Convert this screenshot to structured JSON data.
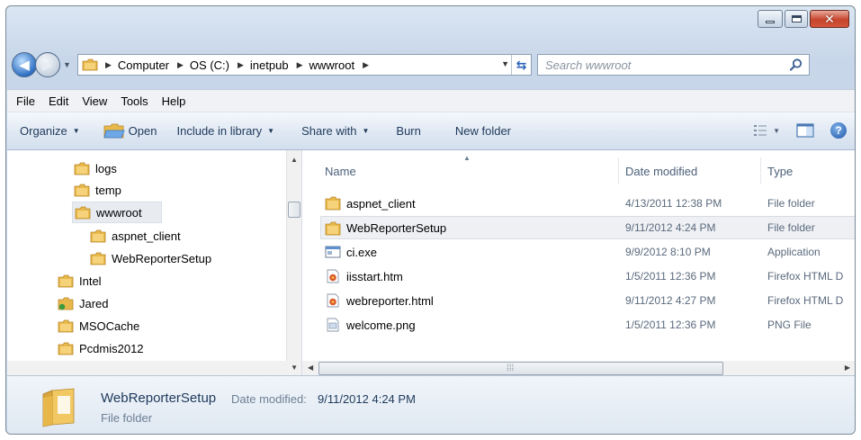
{
  "address": {
    "crumbs": [
      "Computer",
      "OS (C:)",
      "inetpub",
      "wwwroot"
    ],
    "refresh_icon": "refresh-icon"
  },
  "search": {
    "placeholder": "Search wwwroot"
  },
  "menu": {
    "items": [
      "File",
      "Edit",
      "View",
      "Tools",
      "Help"
    ]
  },
  "commands": {
    "organize": "Organize",
    "open": "Open",
    "include_in_library": "Include in library",
    "share_with": "Share with",
    "burn": "Burn",
    "new_folder": "New folder"
  },
  "nav_tree": {
    "items": [
      {
        "label": "logs",
        "icon": "folder-icon"
      },
      {
        "label": "temp",
        "icon": "folder-icon"
      },
      {
        "label": "wwwroot",
        "icon": "folder-icon",
        "selected": true
      },
      {
        "label": "aspnet_client",
        "icon": "folder-icon"
      },
      {
        "label": "WebReporterSetup",
        "icon": "folder-icon"
      },
      {
        "label": "Intel",
        "icon": "folder-icon"
      },
      {
        "label": "Jared",
        "icon": "user-folder-icon"
      },
      {
        "label": "MSOCache",
        "icon": "folder-icon"
      },
      {
        "label": "Pcdmis2012",
        "icon": "folder-icon"
      }
    ]
  },
  "columns": {
    "name": "Name",
    "date_modified": "Date modified",
    "type": "Type"
  },
  "files": [
    {
      "name": "aspnet_client",
      "date": "4/13/2011 12:38 PM",
      "type": "File folder",
      "icon": "folder-icon"
    },
    {
      "name": "WebReporterSetup",
      "date": "9/11/2012 4:24 PM",
      "type": "File folder",
      "icon": "folder-icon",
      "selected": true
    },
    {
      "name": "ci.exe",
      "date": "9/9/2012 8:10 PM",
      "type": "Application",
      "icon": "application-icon"
    },
    {
      "name": "iisstart.htm",
      "date": "1/5/2011 12:36 PM",
      "type": "Firefox HTML D",
      "icon": "html-file-icon"
    },
    {
      "name": "webreporter.html",
      "date": "9/11/2012 4:27 PM",
      "type": "Firefox HTML D",
      "icon": "html-file-icon"
    },
    {
      "name": "welcome.png",
      "date": "1/5/2011 12:36 PM",
      "type": "PNG File",
      "icon": "image-file-icon"
    }
  ],
  "details": {
    "name": "WebReporterSetup",
    "date_label": "Date modified:",
    "date_value": "9/11/2012 4:24 PM",
    "type": "File folder"
  },
  "colors": {
    "accent": "#1e395b",
    "folder": "#e8b94a",
    "close_button": "#c7452d"
  }
}
